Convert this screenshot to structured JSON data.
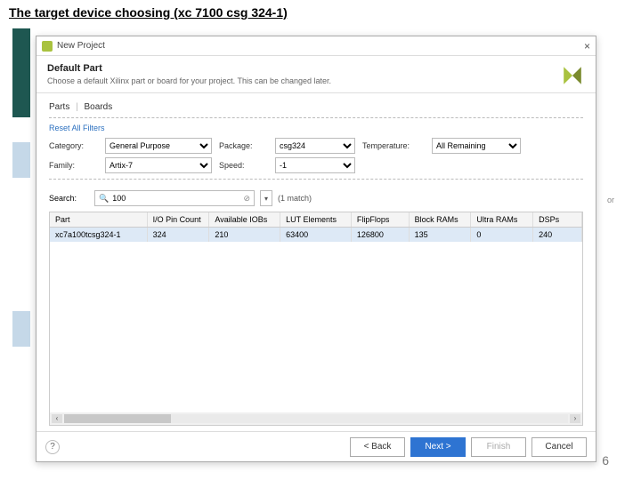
{
  "page": {
    "title": "The target device choosing (xc 7100 csg 324-1)",
    "number": "6",
    "rightNote": "or"
  },
  "dialog": {
    "title": "New Project",
    "header": {
      "title": "Default Part",
      "subtitle": "Choose a default Xilinx part or board for your project. This can be changed later."
    },
    "tabs": {
      "t0": "Parts",
      "t1": "Boards"
    },
    "reset": "Reset All Filters",
    "filters": {
      "categoryLabel": "Category:",
      "categoryValue": "General Purpose",
      "packageLabel": "Package:",
      "packageValue": "csg324",
      "tempLabel": "Temperature:",
      "tempValue": "All Remaining",
      "familyLabel": "Family:",
      "familyValue": "Artix-7",
      "speedLabel": "Speed:",
      "speedValue": "-1"
    },
    "search": {
      "label": "Search:",
      "value": "100",
      "matchText": "(1 match)"
    },
    "table": {
      "headers": {
        "h0": "Part",
        "h1": "I/O Pin Count",
        "h2": "Available IOBs",
        "h3": "LUT Elements",
        "h4": "FlipFlops",
        "h5": "Block RAMs",
        "h6": "Ultra RAMs",
        "h7": "DSPs"
      },
      "row": {
        "c0": "xc7a100tcsg324-1",
        "c1": "324",
        "c2": "210",
        "c3": "63400",
        "c4": "126800",
        "c5": "135",
        "c6": "0",
        "c7": "240"
      }
    },
    "buttons": {
      "back": "< Back",
      "next": "Next >",
      "finish": "Finish",
      "cancel": "Cancel"
    }
  }
}
